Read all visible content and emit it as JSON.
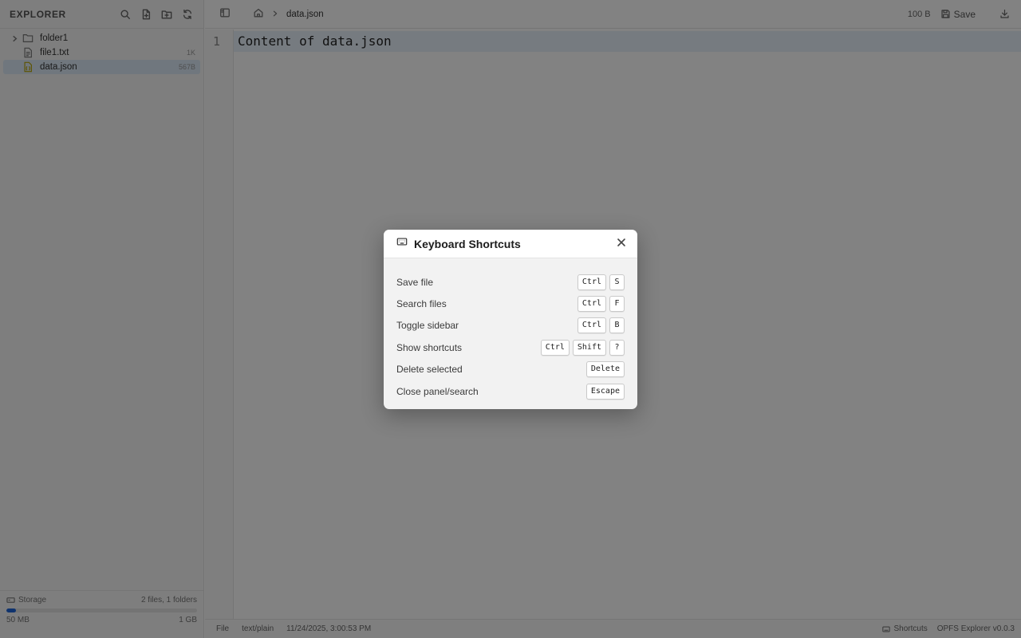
{
  "sidebar": {
    "title": "EXPLORER",
    "actions": [
      "search-icon",
      "new-file-icon",
      "new-folder-icon",
      "refresh-icon"
    ],
    "tree": [
      {
        "name": "folder1",
        "type": "folder",
        "size": ""
      },
      {
        "name": "file1.txt",
        "type": "file",
        "size": "1K"
      },
      {
        "name": "data.json",
        "type": "json",
        "size": "567B",
        "selected": true
      }
    ],
    "footer": {
      "storage_label": "Storage",
      "counts": "2 files, 1 folders",
      "used": "50 MB",
      "total": "1 GB",
      "usage_fraction": 0.05
    }
  },
  "topbar": {
    "filename": "data.json",
    "file_size": "100 B",
    "save_label": "Save"
  },
  "editor": {
    "line_number": "1",
    "content": "Content of data.json"
  },
  "statusbar": {
    "type_label": "File",
    "mime": "text/plain",
    "timestamp": "11/24/2025, 3:00:53 PM",
    "shortcuts_label": "Shortcuts",
    "app_version": "OPFS Explorer v0.0.3"
  },
  "modal": {
    "title": "Keyboard Shortcuts",
    "shortcuts": [
      {
        "label": "Save file",
        "keys": [
          "Ctrl",
          "S"
        ]
      },
      {
        "label": "Search files",
        "keys": [
          "Ctrl",
          "F"
        ]
      },
      {
        "label": "Toggle sidebar",
        "keys": [
          "Ctrl",
          "B"
        ]
      },
      {
        "label": "Show shortcuts",
        "keys": [
          "Ctrl",
          "Shift",
          "?"
        ]
      },
      {
        "label": "Delete selected",
        "keys": [
          "Delete"
        ]
      },
      {
        "label": "Close panel/search",
        "keys": [
          "Escape"
        ]
      }
    ]
  },
  "colors": {
    "accent": "#1e64d8",
    "selection": "#dbe9f7",
    "overlay": "rgba(0,0,0,0.49)"
  }
}
